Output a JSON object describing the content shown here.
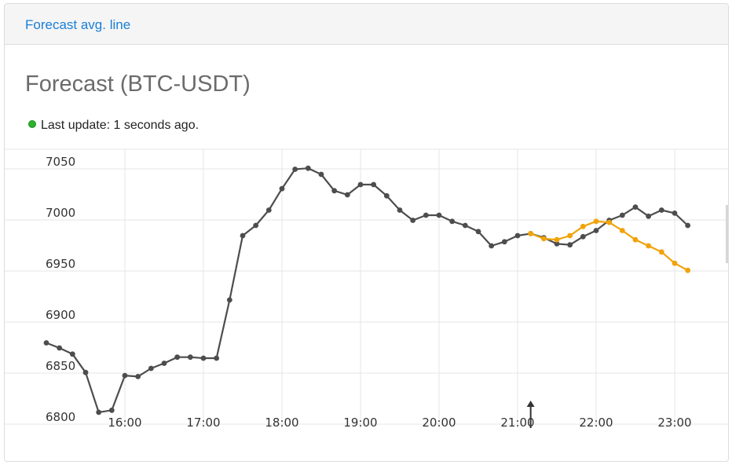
{
  "header": {
    "link_label": "Forecast avg. line"
  },
  "title": "Forecast (BTC-USDT)",
  "status": {
    "text": "Last update: 1 seconds ago.",
    "indicator_color": "#2fb32f"
  },
  "colors": {
    "actual": "#4d4d4d",
    "forecast": "#f0a30a",
    "grid": "#e6e6e6",
    "marker": "#333333"
  },
  "chart_data": {
    "type": "line",
    "title": "",
    "xlabel": "",
    "ylabel": "",
    "ylim": [
      6800,
      7050
    ],
    "yticks": [
      6800,
      6850,
      6900,
      6950,
      7000,
      7050
    ],
    "xticks": [
      "16:00",
      "17:00",
      "18:00",
      "19:00",
      "20:00",
      "21:00",
      "22:00",
      "23:00"
    ],
    "grid": true,
    "current_time_marker": "21:10",
    "series": [
      {
        "name": "",
        "color": "#4d4d4d",
        "x": [
          "15:00",
          "15:10",
          "15:20",
          "15:30",
          "15:40",
          "15:50",
          "16:00",
          "16:10",
          "16:20",
          "16:30",
          "16:40",
          "16:50",
          "17:00",
          "17:10",
          "17:20",
          "17:30",
          "17:40",
          "17:50",
          "18:00",
          "18:10",
          "18:20",
          "18:30",
          "18:40",
          "18:50",
          "19:00",
          "19:10",
          "19:20",
          "19:30",
          "19:40",
          "19:50",
          "20:00",
          "20:10",
          "20:20",
          "20:30",
          "20:40",
          "20:50",
          "21:00",
          "21:10",
          "21:20",
          "21:30",
          "21:40",
          "21:50",
          "22:00",
          "22:10",
          "22:20",
          "22:30",
          "22:40",
          "22:50",
          "23:00",
          "23:10"
        ],
        "y": [
          6875,
          6870,
          6864,
          6846,
          6807,
          6809,
          6843,
          6842,
          6850,
          6855,
          6861,
          6861,
          6860,
          6860,
          6917,
          6980,
          6990,
          7005,
          7026,
          7045,
          7046,
          7040,
          7024,
          7020,
          7030,
          7030,
          7019,
          7005,
          6995,
          7000,
          7000,
          6994,
          6990,
          6984,
          6970,
          6974,
          6980,
          6982,
          6978,
          6972,
          6971,
          6979,
          6985,
          6995,
          7000,
          7008,
          6999,
          7005,
          7002,
          6990
        ]
      },
      {
        "name": "",
        "color": "#f0a30a",
        "x": [
          "21:10",
          "21:20",
          "21:30",
          "21:40",
          "21:50",
          "22:00",
          "22:10",
          "22:20",
          "22:30",
          "22:40",
          "22:50",
          "23:00",
          "23:10"
        ],
        "y": [
          6982,
          6977,
          6976,
          6980,
          6989,
          6994,
          6993,
          6985,
          6976,
          6970,
          6964,
          6953,
          6946
        ]
      }
    ]
  }
}
